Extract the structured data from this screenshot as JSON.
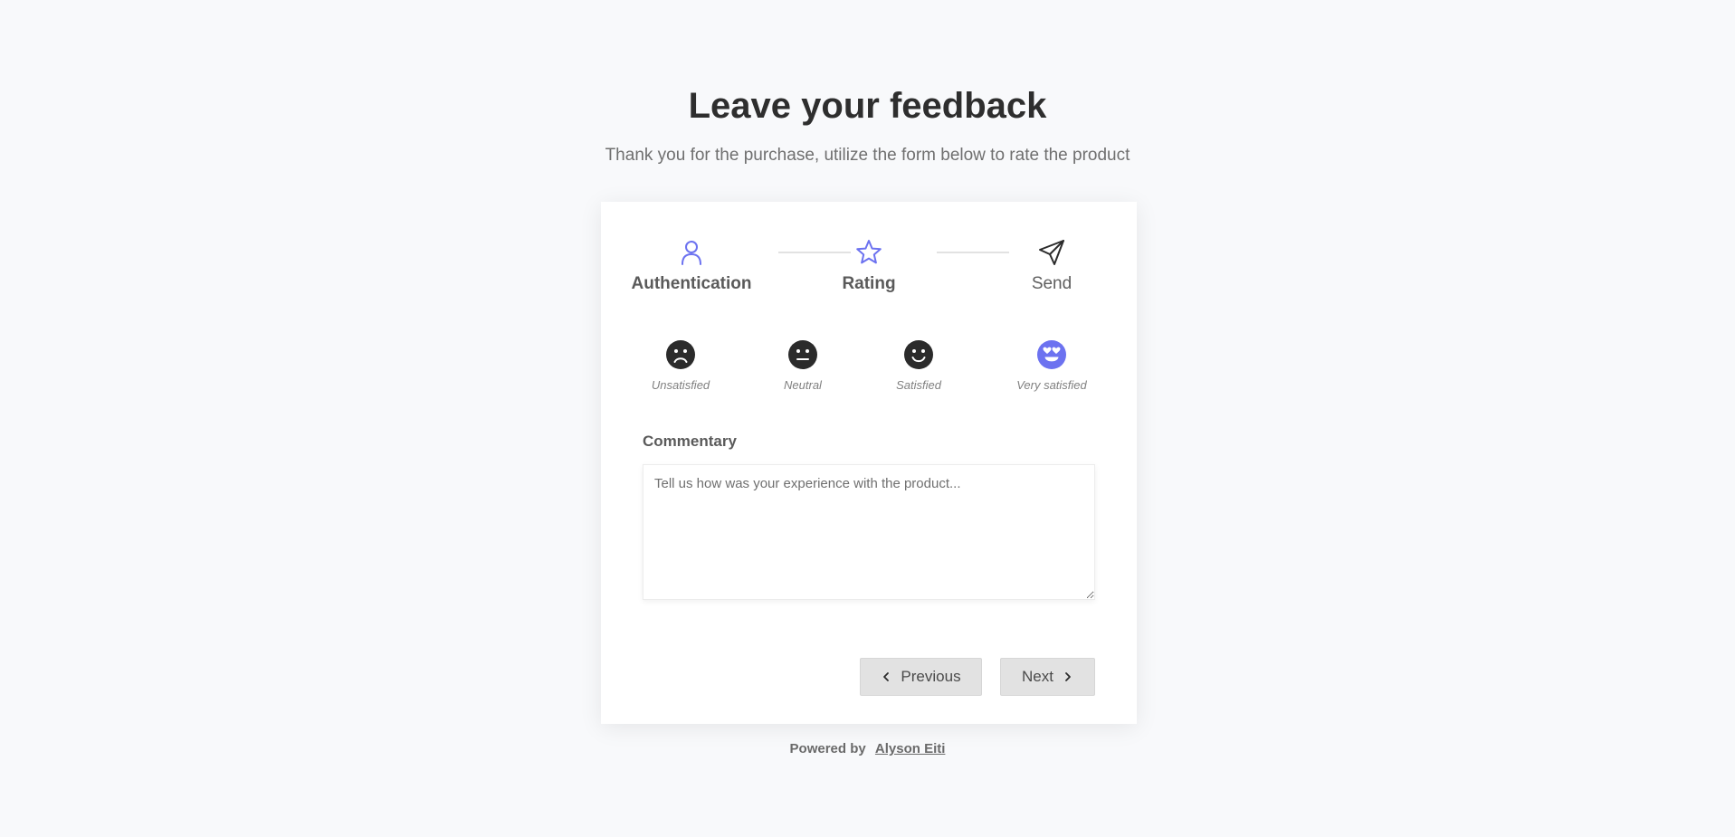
{
  "header": {
    "title": "Leave your feedback",
    "subtitle": "Thank you for the purchase, utilize the form below to rate the product"
  },
  "steps": [
    {
      "label": "Authentication",
      "icon": "user-icon",
      "state": "completed"
    },
    {
      "label": "Rating",
      "icon": "star-icon",
      "state": "active"
    },
    {
      "label": "Send",
      "icon": "send-icon",
      "state": "pending"
    }
  ],
  "ratings": [
    {
      "label": "Unsatisfied",
      "icon": "sad-face-icon",
      "selected": false
    },
    {
      "label": "Neutral",
      "icon": "neutral-face-icon",
      "selected": false
    },
    {
      "label": "Satisfied",
      "icon": "smile-face-icon",
      "selected": false
    },
    {
      "label": "Very satisfied",
      "icon": "heart-eyes-face-icon",
      "selected": true
    }
  ],
  "commentary": {
    "label": "Commentary",
    "placeholder": "Tell us how was your experience with the product...",
    "value": ""
  },
  "buttons": {
    "previous_label": "Previous",
    "next_label": "Next"
  },
  "footer": {
    "prefix": "Powered by",
    "author": "Alyson Eiti"
  },
  "colors": {
    "accent": "#6c72f0",
    "dark": "#2b2b2b",
    "background": "#f8f9fb",
    "button": "#e2e2e2"
  }
}
